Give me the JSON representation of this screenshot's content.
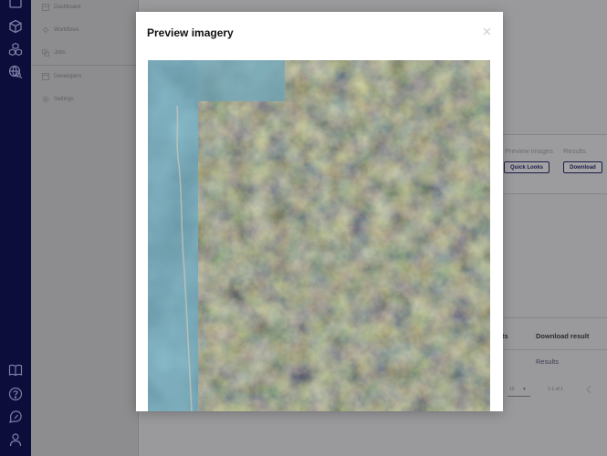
{
  "sidebar": {
    "items": [
      {
        "label": "Dashboard",
        "icon": "dashboard-icon"
      },
      {
        "label": "Workflows",
        "icon": "workflows-icon"
      },
      {
        "label": "Jobs",
        "icon": "jobs-icon"
      },
      {
        "label": "Developers",
        "icon": "developers-icon"
      },
      {
        "label": "Settings",
        "icon": "settings-icon"
      }
    ]
  },
  "rail": {
    "icons": [
      "projects-icon",
      "cube-icon",
      "catalog-icon",
      "search-globe-icon",
      "docs-book-icon",
      "help-icon",
      "feedback-icon",
      "user-icon"
    ]
  },
  "job": {
    "columns": {
      "preview": "Preview images",
      "results": "Results"
    },
    "buttons": {
      "quick_looks": "Quick Looks",
      "download": "Download"
    }
  },
  "results_table": {
    "headers": {
      "col_partial": "ts",
      "download_result": "Download result"
    },
    "row": {
      "download_link": "Results"
    },
    "pagination": {
      "page_size": "10",
      "range": "1-1 of 1"
    }
  },
  "modal": {
    "title": "Preview imagery",
    "close_icon": "close-icon",
    "image_description": "satellite-quicklook"
  },
  "colors": {
    "rail_bg": "#0d0d3b",
    "accent": "#1c1c4a",
    "modal_bg": "#ffffff"
  }
}
